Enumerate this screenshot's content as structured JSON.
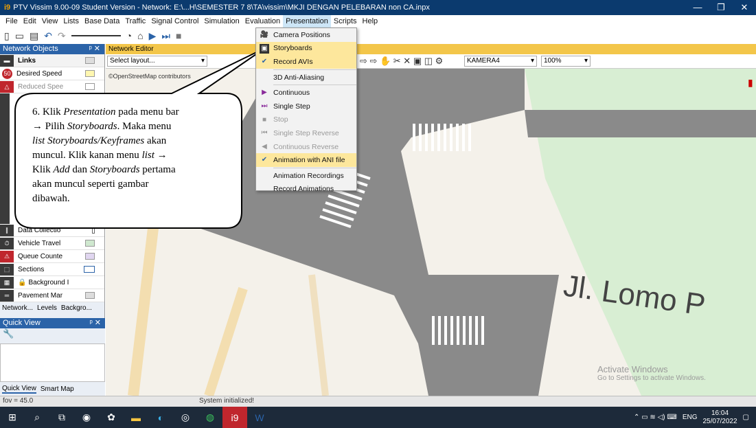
{
  "window": {
    "title": "PTV Vissim 9.00-09 Student Version - Network: E:\\...H\\SEMESTER 7 8\\TA\\vissim\\MKJI DENGAN PELEBARAN non CA.inpx",
    "app_icon": "vissim-icon",
    "minimize": "—",
    "restore": "❐",
    "close": "✕"
  },
  "menubar": [
    "File",
    "Edit",
    "View",
    "Lists",
    "Base Data",
    "Traffic",
    "Signal Control",
    "Simulation",
    "Evaluation",
    "Presentation",
    "Scripts",
    "Help"
  ],
  "left_panel": {
    "title": "Network Objects",
    "header_pin": "ᵖ ✕",
    "rows": [
      {
        "label": "Links",
        "icon": "link-icon"
      },
      {
        "label": "Desired Speed",
        "icon": "speed-50-icon"
      },
      {
        "label": "Reduced Spee",
        "icon": "reduced-speed-icon"
      },
      {
        "label": "Data Collectio",
        "icon": "data-collection-icon"
      },
      {
        "label": "Vehicle Travel",
        "icon": "vehicle-travel-icon"
      },
      {
        "label": "Queue Counte",
        "icon": "queue-counter-icon"
      },
      {
        "label": "Sections",
        "icon": "sections-icon"
      },
      {
        "label": "Background I",
        "icon": "background-icon"
      },
      {
        "label": "Pavement Mar",
        "icon": "pavement-icon"
      }
    ],
    "tabs": [
      "Network...",
      "Levels",
      "Backgro..."
    ]
  },
  "quick_view": {
    "title": "Quick View",
    "tabs": [
      "Quick View",
      "Smart Map"
    ]
  },
  "editor": {
    "title": "Network Editor",
    "layout_placeholder": "Select layout...",
    "osm_credit": "©OpenStreetMap contributors",
    "camera": "KAMERA4",
    "zoom": "100%",
    "street_label": "Jl. Lomo P"
  },
  "presentation_menu": {
    "items": [
      {
        "label": "Camera Positions",
        "icon": "camera-icon",
        "state": "normal"
      },
      {
        "label": "Storyboards",
        "icon": "storyboard-icon",
        "state": "highlight"
      },
      {
        "label": "Record AVIs",
        "icon": "check-icon",
        "state": "highlight"
      },
      {
        "label": "3D Anti-Aliasing",
        "icon": "",
        "state": "normal"
      },
      {
        "label": "Continuous",
        "icon": "play-icon",
        "state": "normal"
      },
      {
        "label": "Single Step",
        "icon": "step-icon",
        "state": "normal"
      },
      {
        "label": "Stop",
        "icon": "stop-icon",
        "state": "disabled"
      },
      {
        "label": "Single Step Reverse",
        "icon": "step-reverse-icon",
        "state": "disabled"
      },
      {
        "label": "Continuous Reverse",
        "icon": "reverse-icon",
        "state": "disabled"
      },
      {
        "label": "Animation with ANI file",
        "icon": "check-icon",
        "state": "highlight"
      },
      {
        "label": "Animation Recordings",
        "icon": "",
        "state": "normal"
      },
      {
        "label": "Record Animations",
        "icon": "",
        "state": "normal"
      }
    ]
  },
  "callout": {
    "line1": "6. Klik ",
    "line1_it": "Presentation",
    "line1_end": " pada menu bar",
    "line2": "→ Pilih ",
    "line2_it": "Storyboards",
    "line2_end": ". Maka menu",
    "line3_it": "list Storyboards/Keyframes",
    "line3_end": " akan",
    "line4": "muncul. Klik kanan menu ",
    "line4_it": "list",
    "line4_end": " →",
    "line5": "Klik ",
    "line5_it": "Add",
    "line5_mid": " dan ",
    "line5_it2": "Storyboards",
    "line5_end": " pertama",
    "line6": "akan muncul seperti gambar",
    "line7": "dibawah."
  },
  "status": {
    "left": "fov = 45.0",
    "center": "System initialized!"
  },
  "watermark": {
    "title": "Activate Windows",
    "subtitle": "Go to Settings to activate Windows."
  },
  "taskbar": {
    "lang": "ENG",
    "time": "16:04",
    "date": "25/07/2022"
  }
}
